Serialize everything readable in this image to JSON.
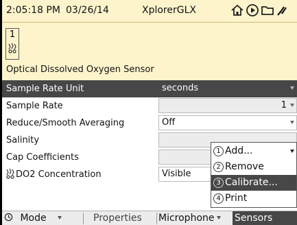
{
  "status": {
    "time": "2:05:18 PM",
    "date": "03/26/14",
    "device": "XplorerGLX",
    "icons": [
      "home-icon",
      "play-circle-icon",
      "folder-icon",
      "plug-icon"
    ]
  },
  "sensor": {
    "port_number": "1",
    "name": "Optical Dissolved Oxygen Sensor"
  },
  "properties": [
    {
      "label": "Sample Rate Unit",
      "value": "seconds",
      "selected": true
    },
    {
      "label": "Sample Rate",
      "value": "1"
    },
    {
      "label": "Reduce/Smooth Averaging",
      "value": "Off"
    },
    {
      "label": "Salinity",
      "value": ""
    },
    {
      "label": "Cap Coefficients",
      "value": ""
    },
    {
      "label": "DO2 Concentration",
      "value": "Visible"
    }
  ],
  "menu": {
    "items": [
      {
        "num": "1",
        "label": "Add..."
      },
      {
        "num": "2",
        "label": "Remove"
      },
      {
        "num": "3",
        "label": "Calibrate...",
        "active": true
      },
      {
        "num": "4",
        "label": "Print"
      }
    ]
  },
  "bottom_bar": {
    "mode_icon": "clock-icon",
    "mode": "Mode",
    "properties": "Properties",
    "microphone": "Microphone",
    "sensors": "Sensors"
  },
  "colors": {
    "status_bg": "#fdf4cc",
    "selected_bg": "#474747",
    "field_bg": "#ececec"
  }
}
